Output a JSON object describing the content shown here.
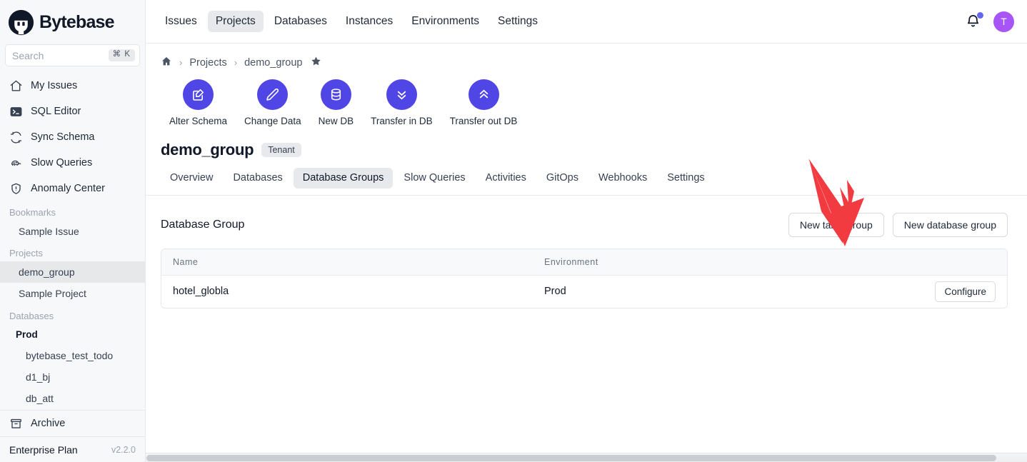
{
  "sidebar": {
    "brand": "Bytebase",
    "brand_icon": "bytebase-logo-icon",
    "search": {
      "placeholder": "Search",
      "shortcut": "⌘ K",
      "value": ""
    },
    "nav": [
      {
        "label": "My Issues",
        "icon": "home-icon"
      },
      {
        "label": "SQL Editor",
        "icon": "terminal-icon"
      },
      {
        "label": "Sync Schema",
        "icon": "sync-icon"
      },
      {
        "label": "Slow Queries",
        "icon": "turtle-icon"
      },
      {
        "label": "Anomaly Center",
        "icon": "shield-alert-icon"
      }
    ],
    "groups": [
      {
        "title": "Bookmarks",
        "items": [
          {
            "label": "Sample Issue",
            "selected": false,
            "bold": false,
            "deep": false
          }
        ]
      },
      {
        "title": "Projects",
        "items": [
          {
            "label": "demo_group",
            "selected": true,
            "bold": false,
            "deep": false
          },
          {
            "label": "Sample Project",
            "selected": false,
            "bold": false,
            "deep": false
          }
        ]
      },
      {
        "title": "Databases",
        "items": [
          {
            "label": "Prod",
            "selected": false,
            "bold": true,
            "deep": false
          },
          {
            "label": "bytebase_test_todo",
            "selected": false,
            "bold": false,
            "deep": true
          },
          {
            "label": "d1_bj",
            "selected": false,
            "bold": false,
            "deep": true
          },
          {
            "label": "db_att",
            "selected": false,
            "bold": false,
            "deep": true
          }
        ]
      }
    ],
    "archive": {
      "label": "Archive",
      "icon": "archive-box-icon"
    },
    "plan": {
      "name": "Enterprise Plan",
      "version": "v2.2.0"
    }
  },
  "topbar": {
    "items": [
      {
        "label": "Issues",
        "active": false
      },
      {
        "label": "Projects",
        "active": true
      },
      {
        "label": "Databases",
        "active": false
      },
      {
        "label": "Instances",
        "active": false
      },
      {
        "label": "Environments",
        "active": false
      },
      {
        "label": "Settings",
        "active": false
      }
    ],
    "bell_icon": "notification-bell-icon",
    "avatar_initial": "T"
  },
  "breadcrumb": {
    "home_icon": "home-icon",
    "sep": "›",
    "parent": "Projects",
    "current": "demo_group",
    "star_icon": "star-filled-icon"
  },
  "actions": [
    {
      "label": "Alter Schema",
      "icon": "edit-square-icon"
    },
    {
      "label": "Change Data",
      "icon": "pencil-icon"
    },
    {
      "label": "New DB",
      "icon": "database-icon"
    },
    {
      "label": "Transfer in DB",
      "icon": "chevrons-down-icon"
    },
    {
      "label": "Transfer out DB",
      "icon": "chevrons-up-icon"
    }
  ],
  "project": {
    "title": "demo_group",
    "badge": "Tenant"
  },
  "tabs": [
    {
      "label": "Overview",
      "active": false
    },
    {
      "label": "Databases",
      "active": false
    },
    {
      "label": "Database Groups",
      "active": true
    },
    {
      "label": "Slow Queries",
      "active": false
    },
    {
      "label": "Activities",
      "active": false
    },
    {
      "label": "GitOps",
      "active": false
    },
    {
      "label": "Webhooks",
      "active": false
    },
    {
      "label": "Settings",
      "active": false
    }
  ],
  "section": {
    "title": "Database Group",
    "new_table_group_label": "New table group",
    "new_database_group_label": "New database group"
  },
  "table": {
    "columns": [
      "Name",
      "Environment",
      ""
    ],
    "rows": [
      {
        "name": "hotel_globla",
        "environment": "Prod",
        "action_label": "Configure"
      }
    ]
  },
  "annotation": {
    "arrow_color": "#f23b41",
    "points_to": "New table group"
  },
  "colors": {
    "accent": "#4f46e5",
    "avatar": "#a855f7",
    "bell_badge": "#6366f1",
    "sidebar_bg": "#f7f8f9",
    "selected_bg": "#e8e9ec"
  }
}
